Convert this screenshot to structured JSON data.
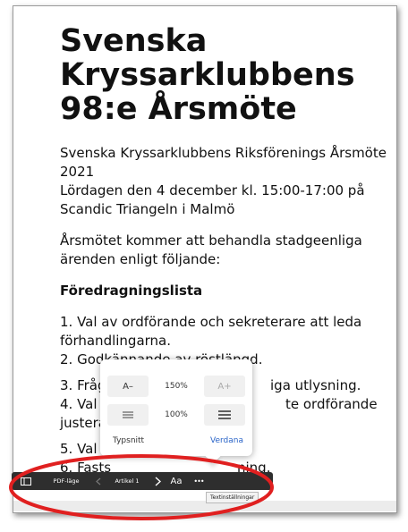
{
  "article": {
    "title_line1": "Svenska",
    "title_line2": "Kryssarklubbens",
    "title_line3": "98:e Årsmöte",
    "intro_line1": "Svenska Kryssarklubbens Riksförenings Årsmöte",
    "intro_line2": "2021",
    "intro_line3": "Lördagen den 4 december kl. 15:00-17:00 på",
    "intro_line4": "Scandic Triangeln i Malmö",
    "para_line1": "Årsmötet kommer att behandla stadgeenliga",
    "para_line2": "ärenden enligt följande:",
    "agenda_heading": "Föredragningslista",
    "item1_line1": "1. Val av ordförande och sekreterare att leda",
    "item1_line2": "förhandlingarna.",
    "item2": "2. Godkännande av röstlängd.",
    "item3": "3. Fråga om mötet har utlysts i behörig ordning, stadgeenliga utlysning.",
    "item3_visible": "3. Fråga",
    "item3_tail": "iga utlysning.",
    "item4_head": "4. Val av",
    "item4_tail": "te ordförande",
    "item4_line2": "justera p",
    "item5": "5. Val av två rösträknare.",
    "item6_head": "6. Fasts",
    "item6_tail": "ning."
  },
  "text_settings_popover": {
    "font_decrease_label": "A–",
    "font_size_value": "150%",
    "font_increase_label": "A+",
    "line_spacing_value": "100%",
    "font_label": "Typsnitt",
    "font_value": "Verdana"
  },
  "toolbar": {
    "pdf_mode_label": "PDF-läge",
    "article_label": "Artikel 1",
    "text_size_label": "Aa",
    "more_label": "•••",
    "tooltip": "Textinställningar"
  },
  "colors": {
    "toolbar_bg": "#2e2e2e",
    "accent": "#2a64c8",
    "annotation": "#e02020"
  }
}
